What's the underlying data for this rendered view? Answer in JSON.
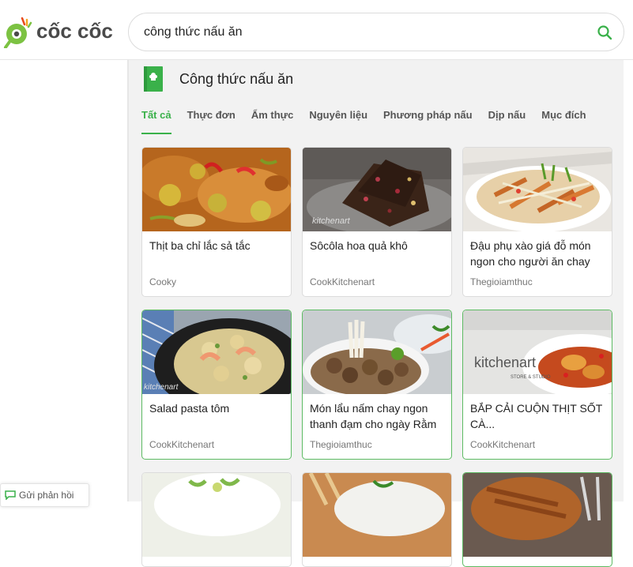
{
  "header": {
    "logo_text": "cốc cốc",
    "search_value": "công thức nấu ăn",
    "brand_green": "#3ab14a"
  },
  "panel": {
    "title": "Công thức nấu ăn",
    "tabs": [
      {
        "label": "Tất cả",
        "active": true
      },
      {
        "label": "Thực đơn"
      },
      {
        "label": "Ẩm thực"
      },
      {
        "label": "Nguyên liệu"
      },
      {
        "label": "Phương pháp nấu"
      },
      {
        "label": "Dịp nấu"
      },
      {
        "label": "Mục đích"
      }
    ]
  },
  "recipes": [
    {
      "title": "Thịt ba chỉ lắc sả tắc",
      "source": "Cooky"
    },
    {
      "title": "Sôcôla hoa quả khô",
      "source": "CookKitchenart"
    },
    {
      "title": "Đậu phụ xào giá đỗ món ngon cho người ăn chay",
      "source": "Thegioiamthuc"
    },
    {
      "title": "Salad pasta tôm",
      "source": "CookKitchenart"
    },
    {
      "title": "Món lẩu nấm chay ngon thanh đạm cho ngày Rằm",
      "source": "Thegioiamthuc"
    },
    {
      "title": "BẮP CẢI CUỘN THỊT SỐT CÀ...",
      "source": "CookKitchenart"
    }
  ],
  "image_text": {
    "kitchen_brand": "kitchenart",
    "kitchen_sub": "STORE & STUDIO",
    "kitchen_small": "kitchenart"
  },
  "feedback_label": "Gửi phản hồi"
}
